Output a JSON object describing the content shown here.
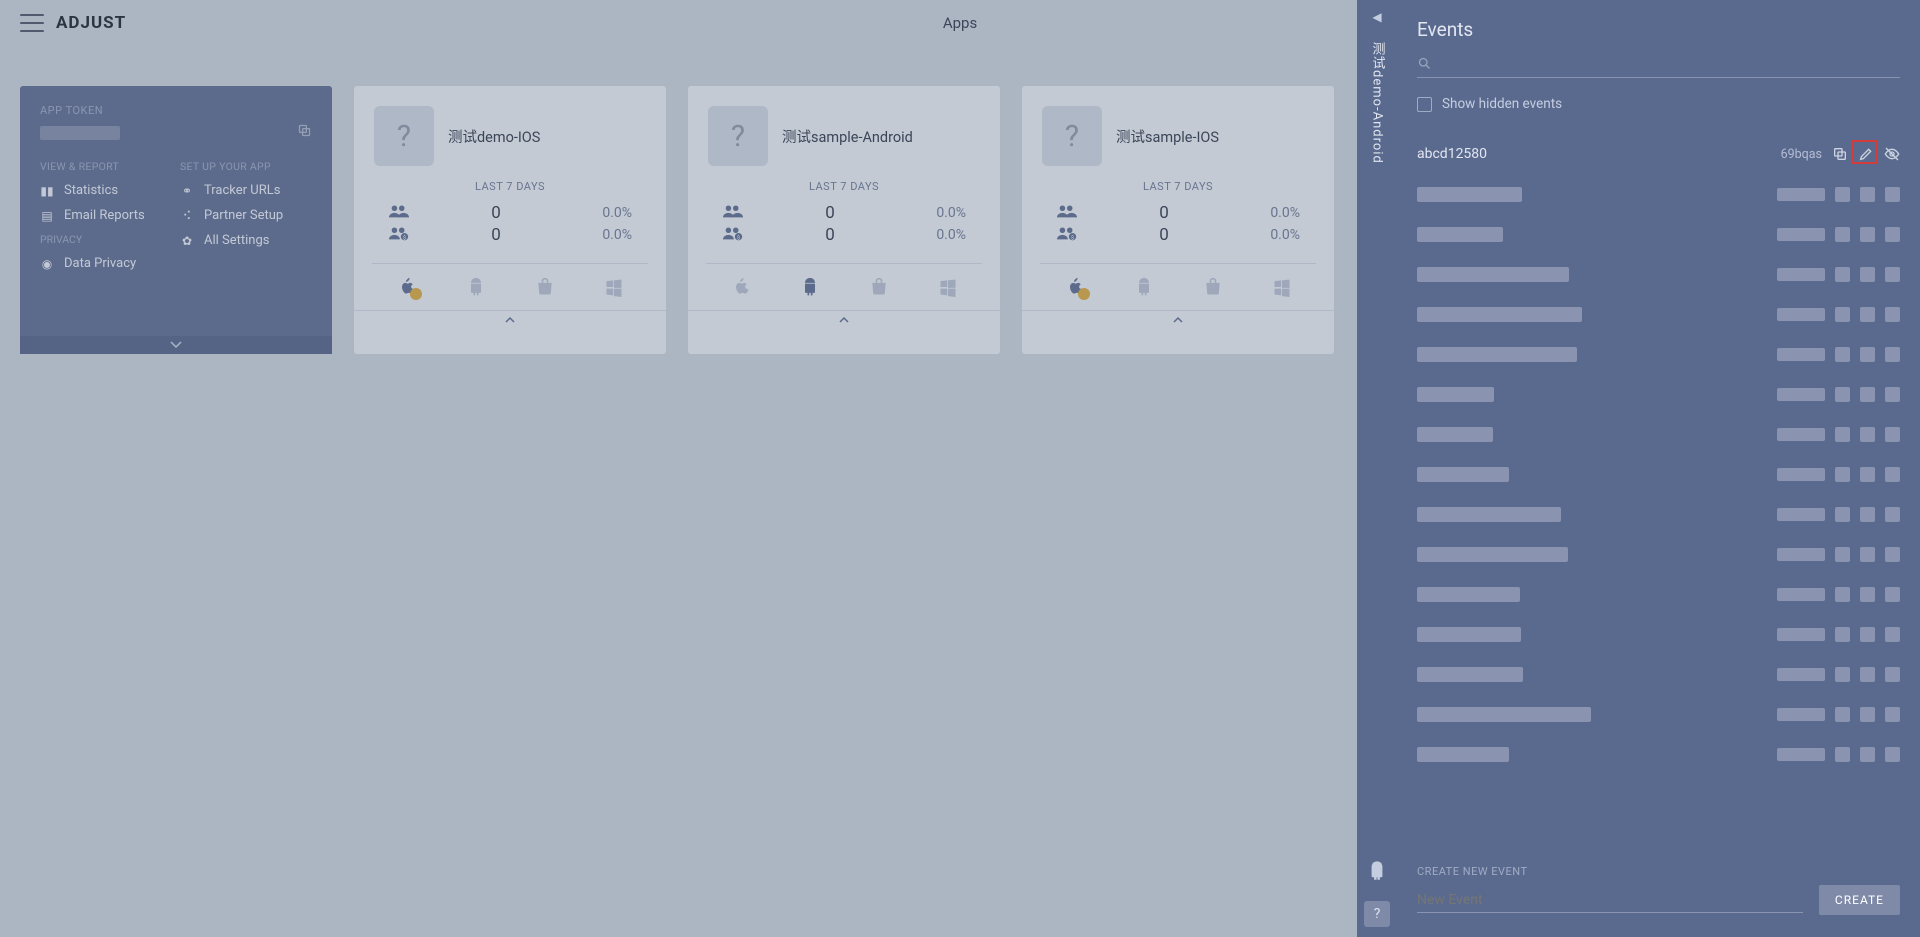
{
  "header": {
    "page_title": "Apps",
    "logo_text": "ADJUST"
  },
  "sidecard": {
    "token_label": "APP TOKEN",
    "col_left_title": "VIEW & REPORT",
    "col_right_title": "SET UP YOUR APP",
    "items_left": [
      "Statistics",
      "Email Reports"
    ],
    "items_right": [
      "Tracker URLs",
      "Partner Setup",
      "All Settings"
    ],
    "privacy_label": "PRIVACY",
    "privacy_item": "Data Privacy"
  },
  "apps": [
    {
      "name": "测试demo-IOS",
      "subtitle": "LAST 7 DAYS",
      "installs": "0",
      "installs_pct": "0.0%",
      "revenue": "0",
      "revenue_pct": "0.0%",
      "active_platform": "apple-warn"
    },
    {
      "name": "测试sample-Android",
      "subtitle": "LAST 7 DAYS",
      "installs": "0",
      "installs_pct": "0.0%",
      "revenue": "0",
      "revenue_pct": "0.0%",
      "active_platform": "android"
    },
    {
      "name": "测试sample-IOS",
      "subtitle": "LAST 7 DAYS",
      "installs": "0",
      "installs_pct": "0.0%",
      "revenue": "0",
      "revenue_pct": "0.0%",
      "active_platform": "apple-warn"
    }
  ],
  "vtab": {
    "label": "测试demo-Android"
  },
  "panel": {
    "title": "Events",
    "show_hidden_label": "Show hidden events",
    "first_event": {
      "name": "abcd12580",
      "token": "69bqas"
    },
    "create_label": "CREATE NEW EVENT",
    "create_placeholder": "New Event",
    "create_button": "CREATE",
    "blurred_row_count": 15
  },
  "help": "?"
}
